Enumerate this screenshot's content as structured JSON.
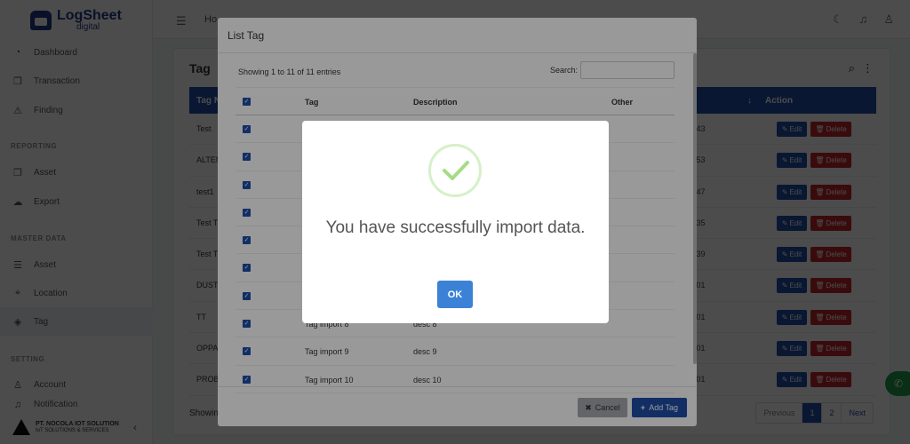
{
  "app": {
    "logo_main": "LogSheet",
    "logo_sub": "digital",
    "company_name": "PT. NOCOLA IOT SOLUTION",
    "company_tagline": "IoT SOLUTIONS & SERVICES"
  },
  "topbar": {
    "breadcrumb": "Ho"
  },
  "sidebar": {
    "items": [
      {
        "label": "Dashboard",
        "icon": "gauge-icon"
      },
      {
        "label": "Transaction",
        "icon": "copy-icon"
      },
      {
        "label": "Finding",
        "icon": "warning-icon"
      }
    ],
    "reporting_title": "REPORTING",
    "reporting_items": [
      {
        "label": "Asset",
        "icon": "copy-icon"
      },
      {
        "label": "Export",
        "icon": "cloud-icon"
      }
    ],
    "master_title": "MASTER DATA",
    "master_items": [
      {
        "label": "Asset",
        "icon": "list-icon"
      },
      {
        "label": "Location",
        "icon": "pin-icon"
      },
      {
        "label": "Tag",
        "icon": "tag-icon"
      }
    ],
    "setting_title": "SETTING",
    "setting_items": [
      {
        "label": "Account",
        "icon": "user-icon"
      },
      {
        "label": "Notification",
        "icon": "bell-icon"
      }
    ]
  },
  "page": {
    "title": "Tag",
    "columns": {
      "tag": "Tag N",
      "sort": "↓",
      "action": "Action"
    },
    "rows": [
      {
        "tag": "Test",
        "time": ":43"
      },
      {
        "tag": "ALTEN",
        "time": ":53"
      },
      {
        "tag": "test1",
        "time": ":47"
      },
      {
        "tag": "Test T",
        "time": ":35"
      },
      {
        "tag": "Test T",
        "time": ":39"
      },
      {
        "tag": "DUST",
        "time": ":01"
      },
      {
        "tag": "TT",
        "time": ":01"
      },
      {
        "tag": "OPPA",
        "time": ":01"
      },
      {
        "tag": "PROB",
        "time": ":01"
      }
    ],
    "edit_label": "Edit",
    "delete_label": "Delete",
    "showing": "Showin",
    "pager": {
      "prev": "Previous",
      "p1": "1",
      "p2": "2",
      "next": "Next"
    }
  },
  "modal": {
    "title": "List Tag",
    "showing": "Showing 1 to 11 of 11 entries",
    "search_label": "Search:",
    "columns": {
      "tag": "Tag",
      "description": "Description",
      "other": "Other"
    },
    "rows": [
      {
        "tag": "",
        "desc": ""
      },
      {
        "tag": "",
        "desc": ""
      },
      {
        "tag": "",
        "desc": ""
      },
      {
        "tag": "",
        "desc": ""
      },
      {
        "tag": "",
        "desc": ""
      },
      {
        "tag": "",
        "desc": ""
      },
      {
        "tag": "",
        "desc": ""
      },
      {
        "tag": "Tag import 8",
        "desc": "desc 8"
      },
      {
        "tag": "Tag import 9",
        "desc": "desc 9"
      },
      {
        "tag": "Tag import 10",
        "desc": "desc 10"
      }
    ],
    "cancel_label": "Cancel",
    "add_label": "Add Tag"
  },
  "alert": {
    "message": "You have successfully import data.",
    "ok_label": "OK"
  }
}
